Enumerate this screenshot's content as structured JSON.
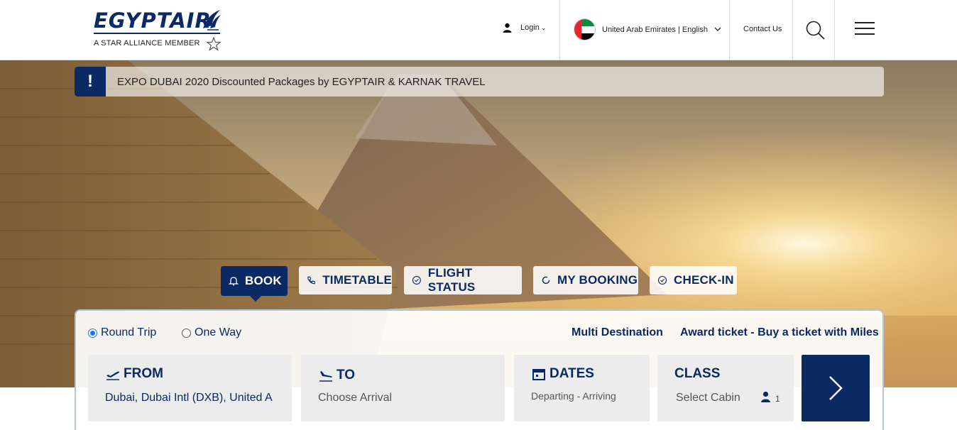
{
  "header": {
    "logo_text": "EGYPTAIR",
    "logo_tagline": "A STAR ALLIANCE MEMBER",
    "login_label": "Login",
    "country_language": "United Arab Emirates | English",
    "contact_label": "Contact Us"
  },
  "banner": {
    "mark": "!",
    "text": "EXPO DUBAI 2020 Discounted Packages by EGYPTAIR & KARNAK TRAVEL"
  },
  "tabs": [
    {
      "label": "BOOK",
      "icon": "bell-icon",
      "active": true
    },
    {
      "label": "TIMETABLE",
      "icon": "phone-icon",
      "active": false
    },
    {
      "label": "FLIGHT STATUS",
      "icon": "check-circle-icon",
      "active": false
    },
    {
      "label": "MY BOOKING",
      "icon": "refresh-icon",
      "active": false
    },
    {
      "label": "CHECK-IN",
      "icon": "check-circle-icon",
      "active": false
    }
  ],
  "booking": {
    "trip_types": [
      {
        "label": "Round Trip",
        "selected": true
      },
      {
        "label": "One Way",
        "selected": false
      }
    ],
    "multi_destination": "Multi Destination",
    "award_ticket": "Award ticket - Buy a ticket with Miles",
    "from": {
      "label": "FROM",
      "value": "Dubai, Dubai Intl (DXB), United A"
    },
    "to": {
      "label": "TO",
      "placeholder": "Choose Arrival"
    },
    "dates": {
      "label": "DATES",
      "placeholder": "Departing - Arriving"
    },
    "class": {
      "label": "CLASS",
      "placeholder": "Select Cabin",
      "passengers": "1"
    }
  },
  "colors": {
    "brand_navy": "#0b2a63",
    "radio_blue": "#1a73e8",
    "field_bg": "#ececec"
  }
}
